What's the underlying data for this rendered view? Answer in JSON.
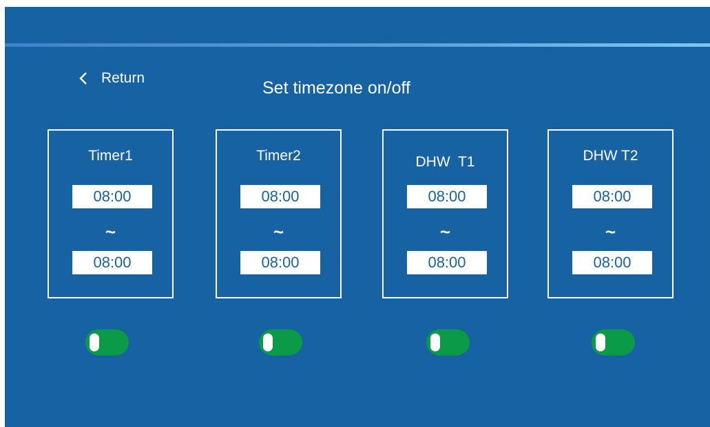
{
  "header": {
    "return_label": "Return",
    "title": "Set timezone on/off"
  },
  "timers": [
    {
      "name": "Timer1",
      "start": "08:00",
      "separator": "~",
      "end": "08:00",
      "enabled": true
    },
    {
      "name": "Timer2",
      "start": "08:00",
      "separator": "~",
      "end": "08:00",
      "enabled": true
    },
    {
      "name": "DHW  T1",
      "start": "08:00",
      "separator": "~",
      "end": "08:00",
      "enabled": true
    },
    {
      "name": "DHW T2",
      "start": "08:00",
      "separator": "~",
      "end": "08:00",
      "enabled": true
    }
  ],
  "icons": {
    "return": "chevron-left-icon"
  },
  "colors": {
    "background": "#1762a2",
    "accent_line": "#5aa3dc",
    "toggle_on": "#0b9a47",
    "field_text": "#1762a2"
  }
}
